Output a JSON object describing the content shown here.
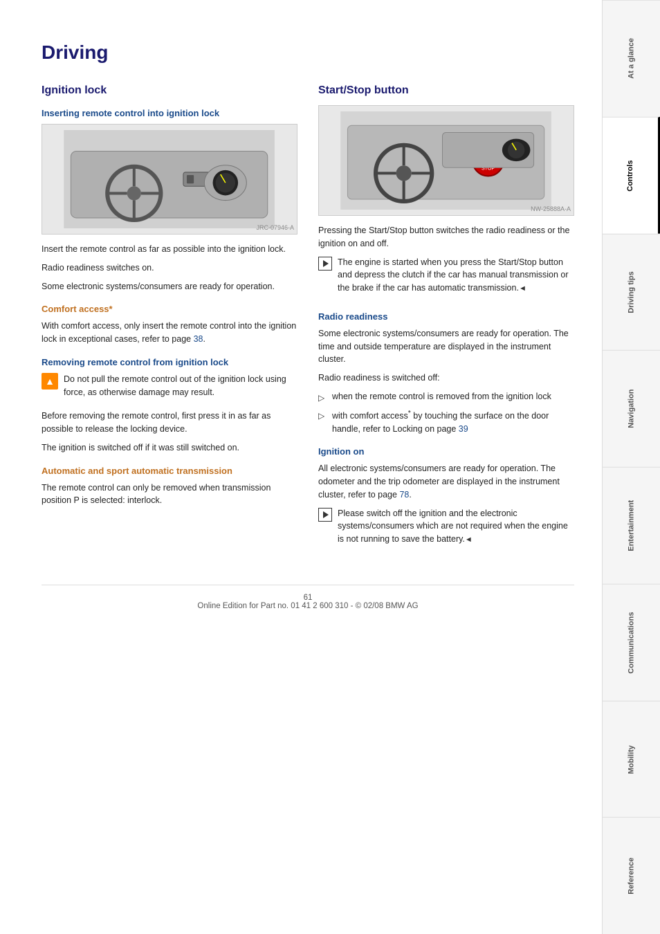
{
  "page": {
    "title": "Driving",
    "footer": "Online Edition for Part no. 01 41 2 600 310 - © 02/08 BMW AG",
    "page_number": "61"
  },
  "left_column": {
    "section_title": "Ignition lock",
    "subsection1_title": "Inserting remote control into ignition lock",
    "image1_label": "JRC-07946-A",
    "insert_para1": "Insert the remote control as far as possible into the ignition lock.",
    "insert_para2": "Radio readiness switches on.",
    "insert_para3": "Some electronic systems/consumers are ready for operation.",
    "comfort_title": "Comfort access*",
    "comfort_para": "With comfort access, only insert the remote control into the ignition lock in exceptional cases, refer to page 38.",
    "comfort_page_ref": "38",
    "removing_title": "Removing remote control from ignition lock",
    "warning_text": "Do not pull the remote control out of the ignition lock using force, as otherwise damage may result.",
    "removing_para1": "Before removing the remote control, first press it in as far as possible to release the locking device.",
    "removing_para2": "The ignition is switched off if it was still switched on.",
    "auto_title": "Automatic and sport automatic transmission",
    "auto_para": "The remote control can only be removed when transmission position P is selected: interlock."
  },
  "right_column": {
    "section_title": "Start/Stop button",
    "image2_label": "NW-25888A-A",
    "startstop_para": "Pressing the Start/Stop button switches the radio readiness or the ignition on and off.",
    "play_text": "The engine is started when you press the Start/Stop button and depress the clutch if the car has manual transmission or the brake if the car has automatic transmission.",
    "radio_title": "Radio readiness",
    "radio_para1": "Some electronic systems/consumers are ready for operation. The time and outside temperature are displayed in the instrument cluster.",
    "radio_para2": "Radio readiness is switched off:",
    "bullet1": "when the remote control is removed from the ignition lock",
    "bullet2": "with comfort access* by touching the surface on the door handle, refer to Locking on page 39",
    "bullet2_page": "39",
    "ignition_on_title": "Ignition on",
    "ignition_para1": "All electronic systems/consumers are ready for operation. The odometer and the trip odometer are displayed in the instrument cluster, refer to page 78.",
    "ignition_page": "78",
    "play_text2": "Please switch off the ignition and the electronic systems/consumers which are not required when the engine is not running to save the battery."
  },
  "sidebar": {
    "items": [
      {
        "label": "At a glance",
        "active": false
      },
      {
        "label": "Controls",
        "active": true
      },
      {
        "label": "Driving tips",
        "active": false
      },
      {
        "label": "Navigation",
        "active": false
      },
      {
        "label": "Entertainment",
        "active": false
      },
      {
        "label": "Communications",
        "active": false
      },
      {
        "label": "Mobility",
        "active": false
      },
      {
        "label": "Reference",
        "active": false
      }
    ]
  }
}
